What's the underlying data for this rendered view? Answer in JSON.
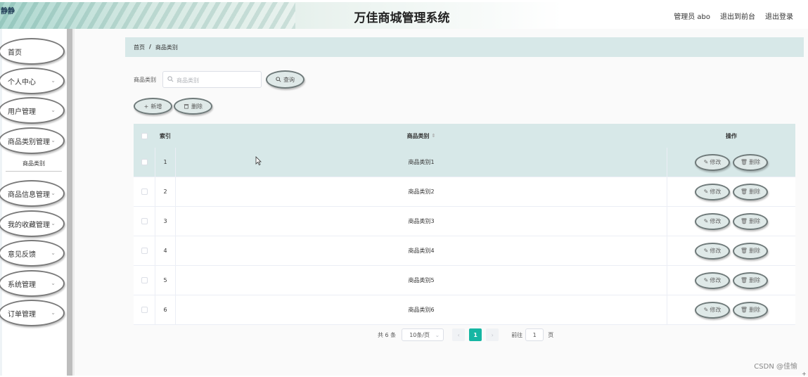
{
  "header": {
    "logo": "静静",
    "title": "万佳商城管理系统",
    "admin_label": "管理员 abo",
    "to_front_label": "退出到前台",
    "logout_label": "退出登录"
  },
  "sidebar": {
    "items": [
      {
        "label": "首页",
        "chevron": ""
      },
      {
        "label": "个人中心",
        "chevron": "⌄"
      },
      {
        "label": "用户管理",
        "chevron": "⌄"
      },
      {
        "label": "商品类别管理",
        "chevron": "⌄"
      },
      {
        "label": "商品信息管理",
        "chevron": "⌄"
      },
      {
        "label": "我的收藏管理",
        "chevron": "⌄"
      },
      {
        "label": "意见反馈",
        "chevron": "⌄"
      },
      {
        "label": "系统管理",
        "chevron": "⌄"
      },
      {
        "label": "订单管理",
        "chevron": "⌄"
      }
    ],
    "submenu_label": "商品类别"
  },
  "breadcrumb": {
    "home": "首页",
    "separator": "/",
    "current": "商品类别"
  },
  "search": {
    "label": "商品类别",
    "placeholder": "商品类别",
    "query_button": "查询"
  },
  "toolbar": {
    "add_label": "新增",
    "delete_label": "删除"
  },
  "table": {
    "headers": {
      "index": "索引",
      "name": "商品类别",
      "ops": "操作"
    },
    "rows": [
      {
        "index": "1",
        "name": "商品类别1"
      },
      {
        "index": "2",
        "name": "商品类别2"
      },
      {
        "index": "3",
        "name": "商品类别3"
      },
      {
        "index": "4",
        "name": "商品类别4"
      },
      {
        "index": "5",
        "name": "商品类别5"
      },
      {
        "index": "6",
        "name": "商品类别6"
      }
    ],
    "edit_label": "修改",
    "row_delete_label": "删除"
  },
  "pagination": {
    "total": "共 6 条",
    "page_size": "10条/页",
    "current_page": "1",
    "goto_label": "前往",
    "goto_value": "1",
    "page_unit": "页"
  },
  "watermark": "CSDN @佳愉",
  "colors": {
    "accent": "#16b6a3",
    "header_row_bg": "#d7e8e8"
  }
}
